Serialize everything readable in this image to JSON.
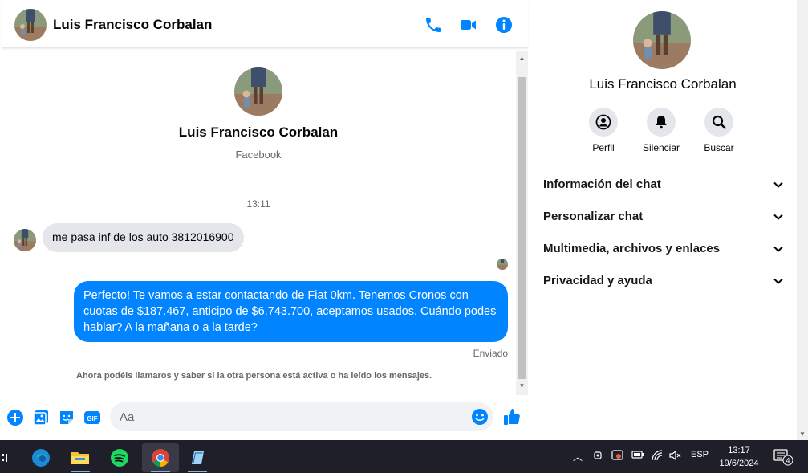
{
  "header": {
    "contact_name": "Luis Francisco Corbalan",
    "call_icon": "phone-icon",
    "video_icon": "video-camera-icon",
    "info_icon": "info-icon"
  },
  "thread": {
    "name": "Luis Francisco Corbalan",
    "source": "Facebook",
    "time": "13:11",
    "incoming_message": "me pasa inf de los auto 3812016900",
    "outgoing_message": "Perfecto! Te vamos a estar contactando de Fiat 0km. Tenemos Cronos con cuotas de $187.467, anticipo de $6.743.700, aceptamos usados. Cuándo podes hablar? A la mañana o a la tarde?",
    "status": "Enviado",
    "notice": "Ahora podéis llamaros y saber si la otra persona está activa o ha leído los mensajes."
  },
  "composer": {
    "placeholder": "Aa",
    "icons": [
      "plus-circle-icon",
      "photo-icon",
      "sticker-icon",
      "gif-icon",
      "emoji-icon",
      "like-icon"
    ],
    "gif_label": "GIF"
  },
  "info_panel": {
    "name": "Luis Francisco Corbalan",
    "actions": [
      {
        "label": "Perfil",
        "icon": "profile-icon"
      },
      {
        "label": "Silenciar",
        "icon": "bell-icon"
      },
      {
        "label": "Buscar",
        "icon": "search-icon"
      }
    ],
    "sections": [
      {
        "label": "Información del chat"
      },
      {
        "label": "Personalizar chat"
      },
      {
        "label": "Multimedia, archivos y enlaces"
      },
      {
        "label": "Privacidad y ayuda"
      }
    ]
  },
  "taskbar": {
    "apps": [
      "edge-icon",
      "file-explorer-icon",
      "spotify-icon",
      "chrome-icon",
      "notepad-icon"
    ],
    "language": "ESP",
    "time": "13:17",
    "date": "19/6/2024",
    "notification_count": "4"
  },
  "colors": {
    "accent": "#0084ff",
    "incoming_bubble": "#e4e6eb",
    "taskbar": "#1f1f29"
  }
}
